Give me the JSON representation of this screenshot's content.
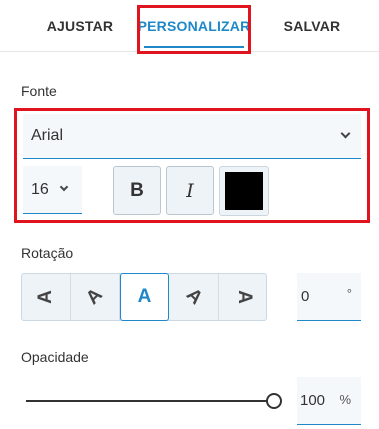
{
  "tabs": [
    {
      "label": "AJUSTAR"
    },
    {
      "label": "PERSONALIZAR",
      "active": true
    },
    {
      "label": "SALVAR"
    }
  ],
  "font": {
    "section_label": "Fonte",
    "family": "Arial",
    "size": "16",
    "bold_label": "B",
    "italic_label": "I",
    "color": "#000000"
  },
  "rotation": {
    "section_label": "Rotação",
    "buttons": [
      {
        "glyph": "A",
        "angle_deg": -90
      },
      {
        "glyph": "A",
        "angle_deg": -45
      },
      {
        "glyph": "A",
        "angle_deg": 0,
        "active": true
      },
      {
        "glyph": "A",
        "angle_deg": 45
      },
      {
        "glyph": "A",
        "angle_deg": 90
      }
    ],
    "value": "0",
    "unit": "°"
  },
  "opacity": {
    "section_label": "Opacidade",
    "value": "100",
    "unit": "%",
    "slider_fraction": 1.0
  },
  "colors": {
    "accent": "#1e88c8",
    "highlight": "#e0141e"
  }
}
